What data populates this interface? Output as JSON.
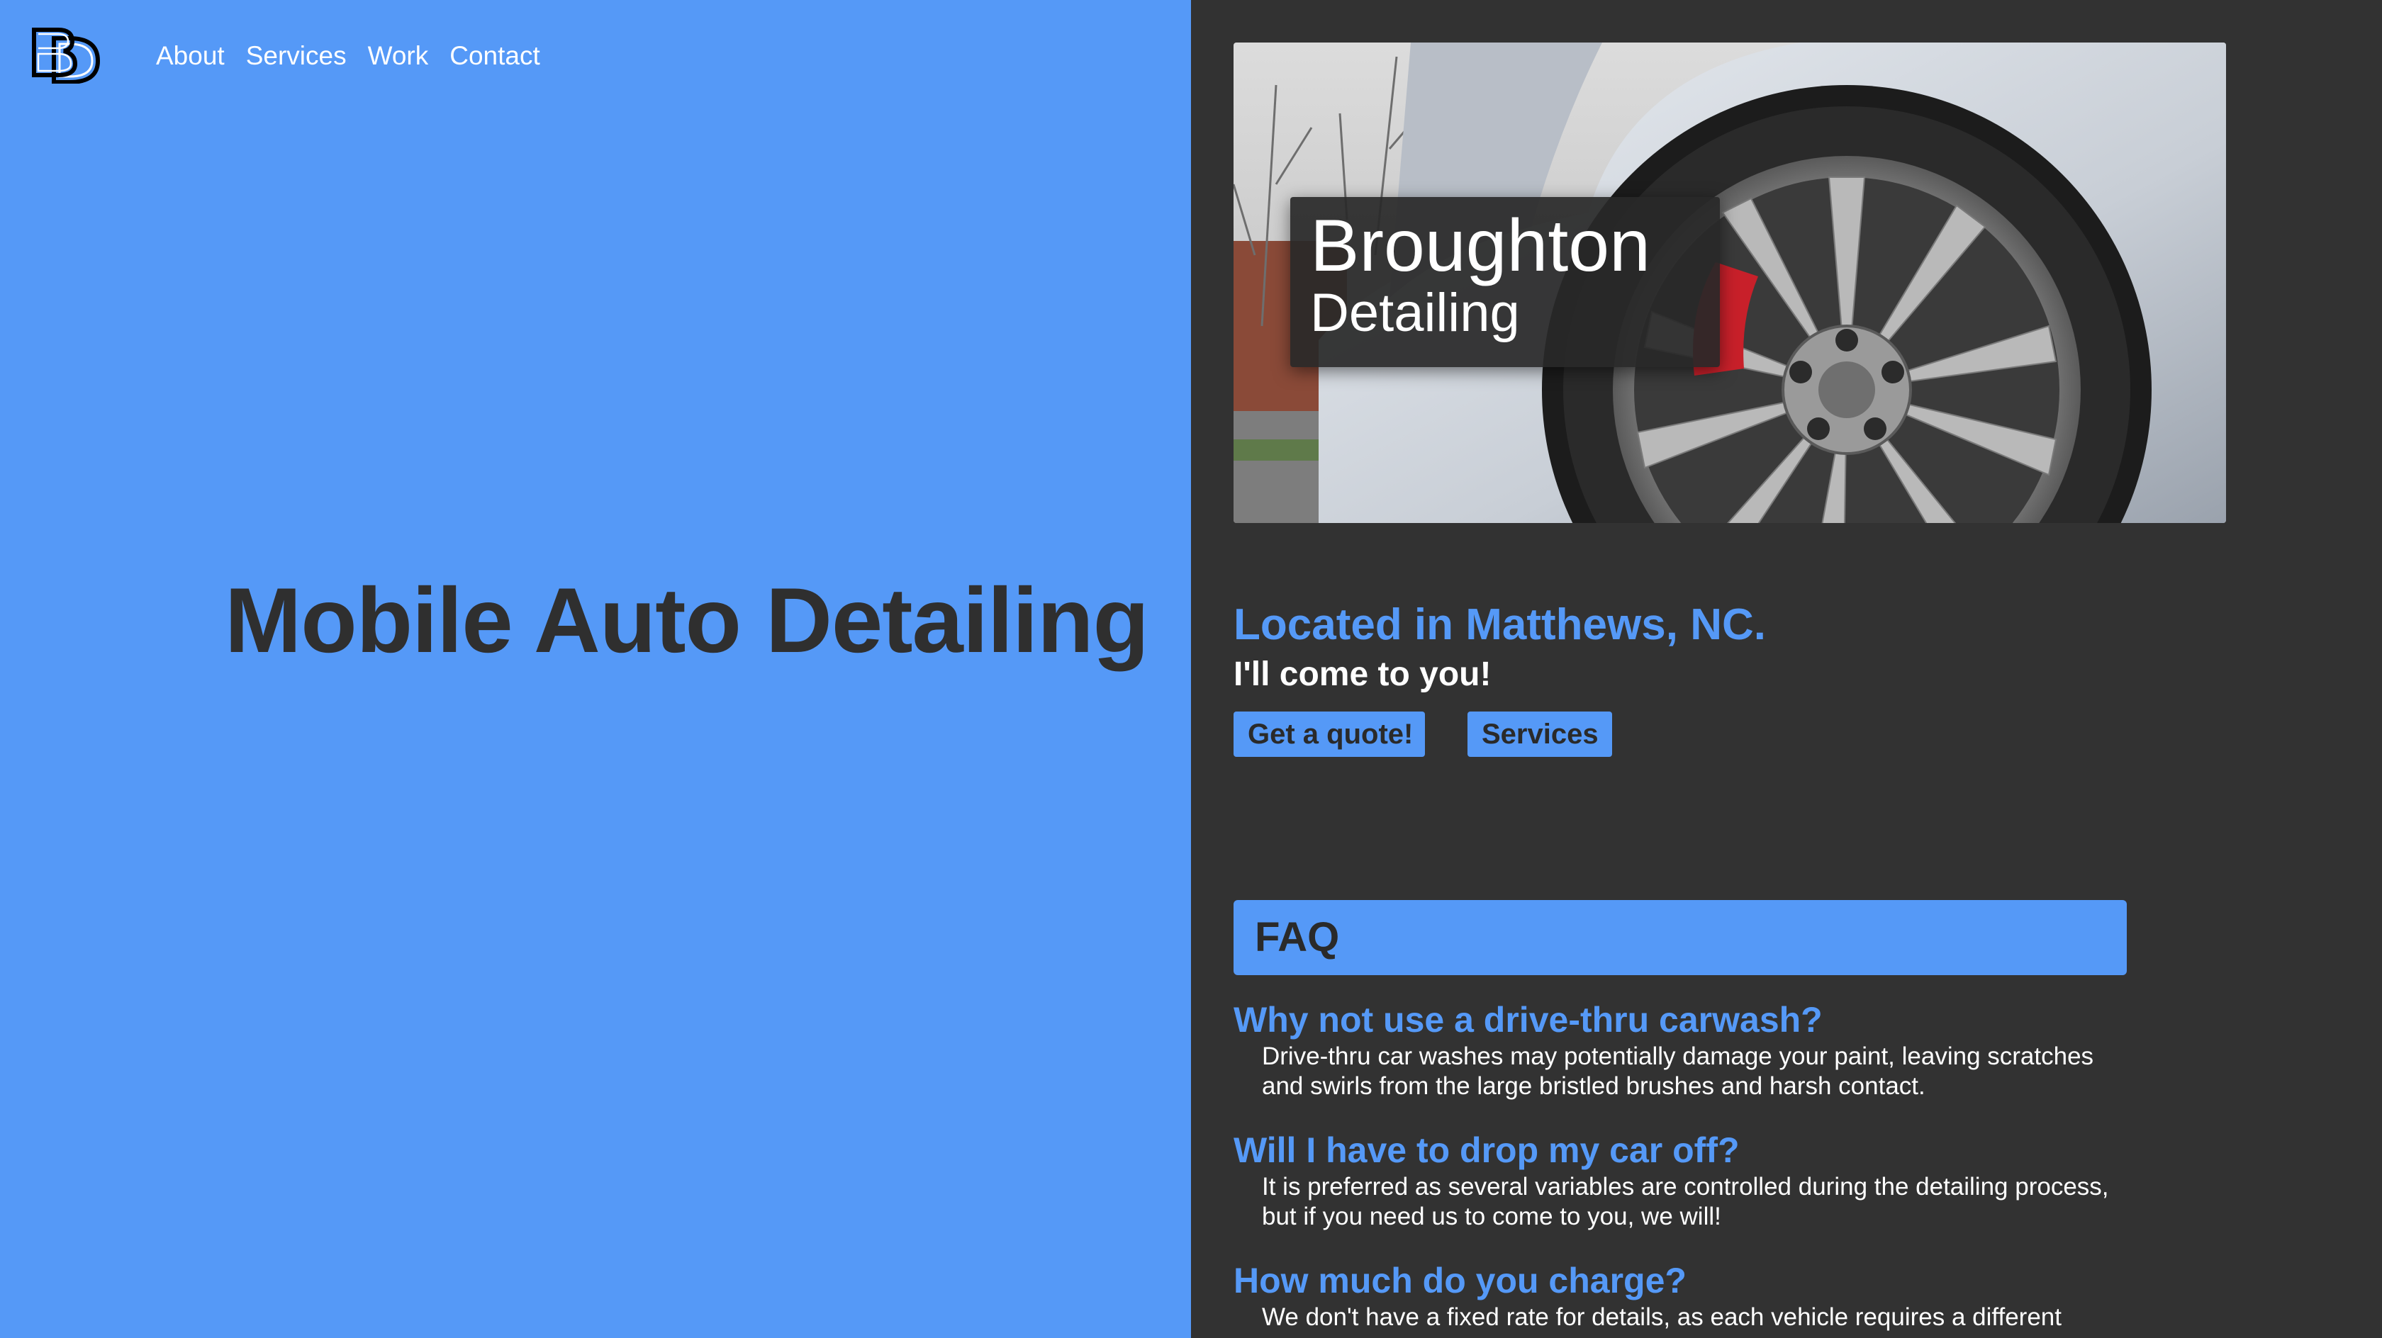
{
  "logo": {
    "text": "BD"
  },
  "nav": {
    "items": [
      "About",
      "Services",
      "Work",
      "Contact"
    ]
  },
  "hero": {
    "title": "Mobile Auto Detailing"
  },
  "brand": {
    "name": "Broughton",
    "sub": "Detailing"
  },
  "location": {
    "heading": "Located in Matthews, NC.",
    "subheading": "I'll come to you!"
  },
  "buttons": {
    "quote": "Get a quote!",
    "services": "Services"
  },
  "faq": {
    "title": "FAQ",
    "items": [
      {
        "q": "Why not use a drive-thru carwash?",
        "a": "Drive-thru car washes may potentially damage your paint, leaving scratches and swirls from the large bristled brushes and harsh contact."
      },
      {
        "q": "Will I have to drop my car off?",
        "a": "It is preferred as several variables are controlled during the detailing process, but if you need us to come to you, we will!"
      },
      {
        "q": "How much do you charge?",
        "a": "We don't have a fixed rate for details, as each vehicle requires a different"
      }
    ]
  },
  "colors": {
    "accent": "#5599f7",
    "dark": "#323232",
    "heading_dark": "#2f2f2f"
  }
}
